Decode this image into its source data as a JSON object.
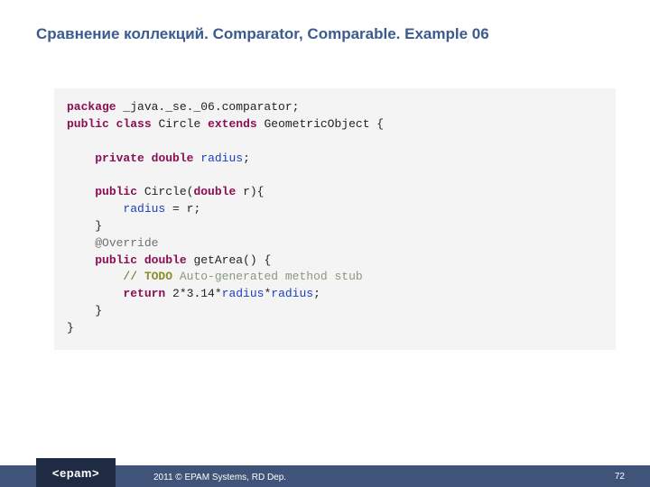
{
  "title": "Сравнение коллекций. Comparator, Comparable. Example 06",
  "code": {
    "kw_package": "package",
    "pkg": " _java._se._06.comparator;",
    "kw_public1": "public",
    "kw_class": "class",
    "cls": " Circle ",
    "kw_extends": "extends",
    "sup": " GeometricObject {",
    "kw_private": "private",
    "kw_double1": "double",
    "fld_radius1": "radius",
    "semi": ";",
    "kw_public2": "public",
    "ctor_sig_a": " Circle(",
    "kw_double2": "double",
    "ctor_sig_b": " r){",
    "fld_radius2": "radius",
    "assign": " = r;",
    "brace_close": "}",
    "ann_override": "@Override",
    "kw_public3": "public",
    "kw_double3": "double",
    "method_sig": " getArea() {",
    "comment_prefix": "// ",
    "comment_kw": "TODO",
    "comment_rest": " Auto-generated method stub",
    "kw_return": "return",
    "ret_a": " 2*3.14*",
    "fld_radius3": "radius",
    "star": "*",
    "fld_radius4": "radius"
  },
  "logo": "<epam>",
  "footer_year": "2011 ",
  "footer_cpy": "©",
  "footer_rest": " EPAM Systems, RD Dep.",
  "page": "72"
}
